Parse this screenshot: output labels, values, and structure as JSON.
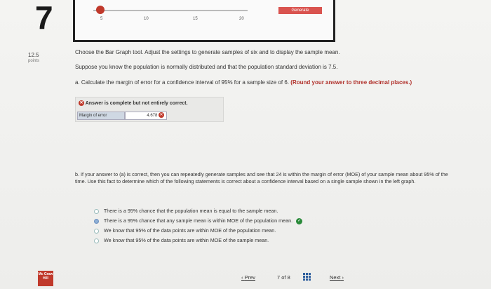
{
  "question": {
    "number": "7",
    "points_value": "12.5",
    "points_label": "points"
  },
  "tool": {
    "ticks": [
      "5",
      "10",
      "15",
      "20"
    ],
    "generate_label": "Generate"
  },
  "prompt": {
    "line1": "Choose the Bar Graph tool. Adjust the settings to generate samples of six and to display the sample mean.",
    "line2": "Suppose you know the population is normally distributed and that the population standard deviation is 7.5.",
    "part_a_text": "a. Calculate the margin of error for a confidence interval of 95% for a sample size of 6.",
    "part_a_hint": "(Round your answer to three decimal places.)"
  },
  "answer": {
    "status": "Answer is complete but not entirely correct.",
    "moe_label": "Margin of error",
    "moe_value": "4.678"
  },
  "part_b": {
    "text": "b. If your answer to (a) is correct, then you can repeatedly generate samples and see that 24 is within the margin of error (MOE) of your sample mean about 95% of the time. Use this fact to determine which of the following statements is correct about a confidence interval based on a single sample shown in the left graph.",
    "options": [
      "There is a 95% chance that the population mean is equal to the sample mean.",
      "There is a 95% chance that any sample mean is within MOE of the population mean.",
      "We know that 95% of the data points are within MOE of the population mean.",
      "We know that 95% of the data points are within MOE of the sample mean."
    ]
  },
  "footer": {
    "logo_text": "Mc Graw Hill",
    "prev_label": "Prev",
    "page_current": "7",
    "page_of": "of",
    "page_total": "8",
    "next_label": "Next"
  }
}
